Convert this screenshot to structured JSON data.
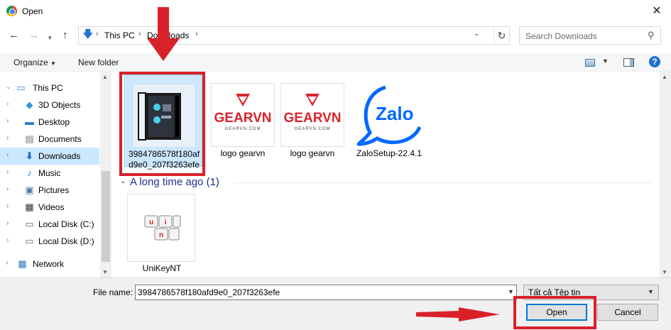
{
  "window": {
    "title": "Open"
  },
  "address": {
    "segments": [
      "This PC",
      "Downloads"
    ],
    "search_placeholder": "Search Downloads"
  },
  "toolbar": {
    "organize": "Organize",
    "new_folder": "New folder"
  },
  "sidebar": {
    "items": [
      {
        "label": "This PC",
        "icon": "computer-icon"
      },
      {
        "label": "3D Objects",
        "icon": "cube-icon"
      },
      {
        "label": "Desktop",
        "icon": "desktop-icon"
      },
      {
        "label": "Documents",
        "icon": "document-icon"
      },
      {
        "label": "Downloads",
        "icon": "download-arrow-icon"
      },
      {
        "label": "Music",
        "icon": "music-note-icon"
      },
      {
        "label": "Pictures",
        "icon": "picture-icon"
      },
      {
        "label": "Videos",
        "icon": "film-icon"
      },
      {
        "label": "Local Disk (C:)",
        "icon": "drive-icon"
      },
      {
        "label": "Local Disk (D:)",
        "icon": "drive-icon"
      },
      {
        "label": "Network",
        "icon": "network-icon"
      }
    ]
  },
  "files": [
    {
      "name": "3984786578f180afd9e0_207f3263efe",
      "thumb": "pc-case"
    },
    {
      "name": "logo gearvn",
      "thumb": "gearvn",
      "logo_text": "GEARVN",
      "logo_sub": "GEARVN.COM"
    },
    {
      "name": "logo gearvn",
      "thumb": "gearvn",
      "logo_text": "GEARVN",
      "logo_sub": "GEARVN.COM"
    },
    {
      "name": "ZaloSetup-22.4.1",
      "thumb": "zalo",
      "logo_text": "Zalo"
    }
  ],
  "group": {
    "label": "A long time ago (1)"
  },
  "old_files": [
    {
      "name": "UniKeyNT",
      "keys": [
        "u",
        "i",
        "n"
      ]
    }
  ],
  "bottom": {
    "file_name_label": "File name:",
    "file_name_value": "3984786578f180afd9e0_207f3263efe",
    "file_type": "Tất cả Tệp tin",
    "open_label": "Open",
    "cancel_label": "Cancel"
  },
  "colors": {
    "accent": "#0078d7",
    "annotation_red": "#d9212a",
    "gearvn_red": "#d9232d",
    "zalo_blue": "#0068ff"
  }
}
